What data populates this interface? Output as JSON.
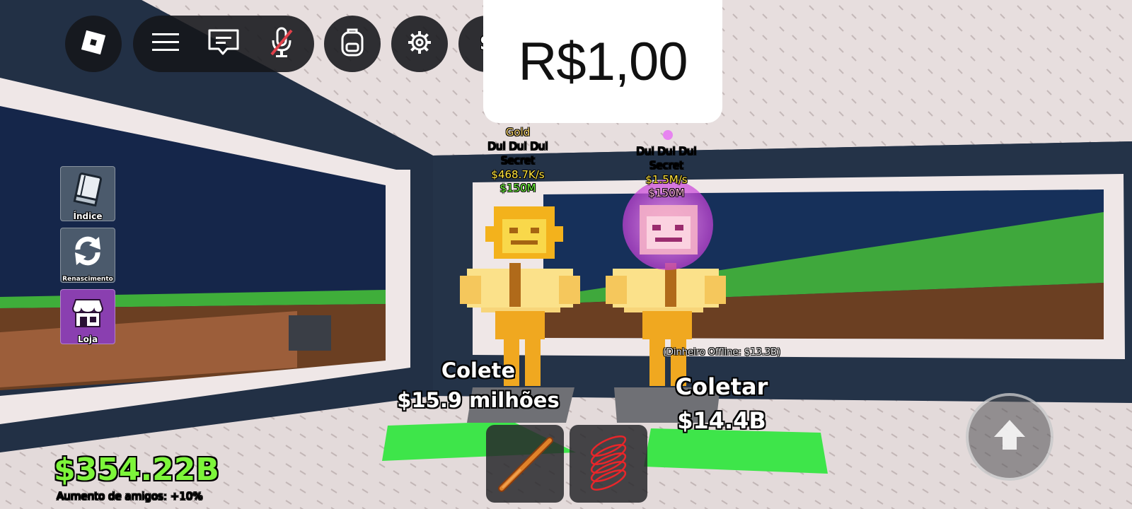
{
  "topbar": {
    "roblox_icon": "roblox-logo-icon",
    "menu_icon": "hamburger-menu-icon",
    "chat_icon": "chat-icon",
    "mic_icon": "microphone-muted-icon",
    "backpack_icon": "backpack-icon",
    "settings_icon": "gear-icon",
    "partial_button_label": "S"
  },
  "price_popup": {
    "label": "R$1,00"
  },
  "side_menu": [
    {
      "label": "Índice",
      "icon": "book-icon"
    },
    {
      "label": "Renascimento",
      "icon": "refresh-icon"
    },
    {
      "label": "Loja",
      "icon": "shop-icon"
    }
  ],
  "characters": [
    {
      "mutation": "Gold",
      "name": "Dul Dul Dul",
      "rarity": "Secret",
      "rate": "$468.7K/s",
      "price": "$150M"
    },
    {
      "mutation": "",
      "name": "Dul Dul Dul",
      "rarity": "Secret",
      "rate": "$1.5M/s",
      "price": "$150M"
    }
  ],
  "collectors": [
    {
      "title": "Colete",
      "amount": "$15.9 milhões",
      "offline": ""
    },
    {
      "title": "Coletar",
      "amount": "$14.4B",
      "offline": "(Dinheiro Offline: $13.3B)"
    }
  ],
  "hotbar": [
    {
      "item": "bat-icon"
    },
    {
      "item": "coil-spring-icon"
    }
  ],
  "money": {
    "amount": "$354.22B",
    "boost": "Aumento de amigos: +10%"
  },
  "jump_icon": "up-arrow-icon",
  "colors": {
    "money_green": "#7df53a",
    "rate_yellow": "#ffe33d",
    "price_green": "#6cf53a",
    "pad_green": "#3ee54a",
    "gold": "#f0a820",
    "pink_aura": "#e070e8"
  }
}
